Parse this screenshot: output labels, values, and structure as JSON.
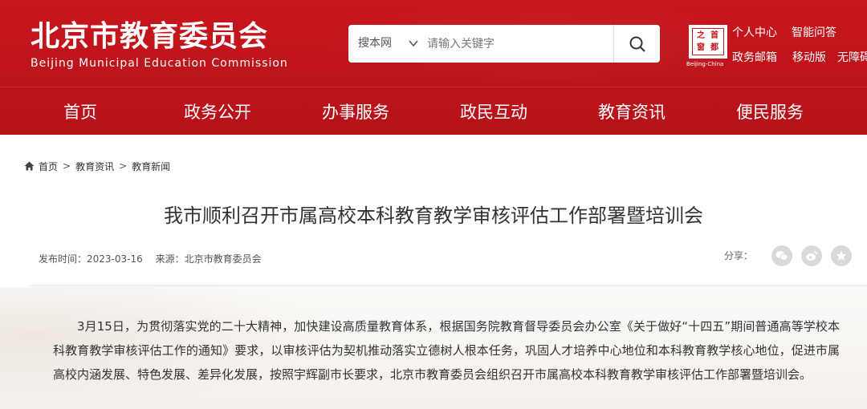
{
  "header": {
    "title": "北京市教育委员会",
    "subtitle": "Beijing Municipal Education Commission",
    "search": {
      "scope": "搜本网",
      "placeholder": "请输入关键字"
    },
    "seal": {
      "chars": [
        "首",
        "之",
        "都",
        "窗"
      ],
      "caption": "Beijing-China"
    },
    "top_links": [
      "个人中心",
      "智能问答",
      "政务邮箱",
      "移动版",
      "无障碍"
    ],
    "colors": {
      "brand": "#c8161d"
    }
  },
  "nav": {
    "items": [
      "首页",
      "政务公开",
      "办事服务",
      "政民互动",
      "教育资讯",
      "便民服务"
    ]
  },
  "breadcrumb": {
    "items": [
      "首页",
      "教育资讯",
      "教育新闻"
    ],
    "separator": ">"
  },
  "article": {
    "title": "我市顺利召开市属高校本科教育教学审核评估工作部署暨培训会",
    "publish_time": "发布时间：2023-03-16",
    "source": "来源：北京市教育委员会",
    "share_label": "分享：",
    "share_icons": [
      "wechat-icon",
      "weibo-icon",
      "star-icon"
    ],
    "paragraph": "3月15日，为贯彻落实党的二十大精神，加快建设高质量教育体系，根据国务院教育督导委员会办公室《关于做好“十四五”期间普通高等学校本科教育教学审核评估工作的通知》要求，以审核评估为契机推动落实立德树人根本任务，巩固人才培养中心地位和本科教育教学核心地位，促进市属高校内涵发展、特色发展、差异化发展，按照宇辉副市长要求，北京市教育委员会组织召开市属高校本科教育教学审核评估工作部署暨培训会。"
  }
}
